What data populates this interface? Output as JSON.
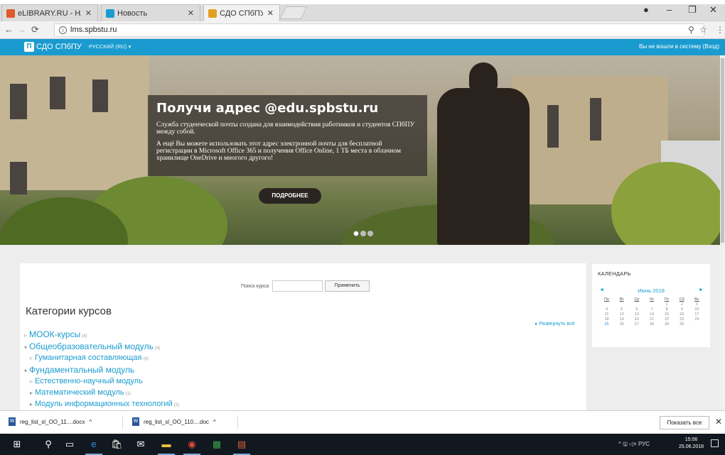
{
  "browser": {
    "tabs": [
      {
        "title": "eLIBRARY.RU - НАУЧНАЯ",
        "close": "✕",
        "color": "#e05a2b"
      },
      {
        "title": "Новость",
        "close": "✕",
        "color": "#1a9bd0"
      },
      {
        "title": "СДО СПбПУ",
        "close": "✕",
        "color": "#e0a020"
      }
    ],
    "url": "lms.spbstu.ru",
    "window_controls": {
      "minimize": "–",
      "maximize": "❐",
      "close": "✕"
    }
  },
  "site": {
    "logo": "П",
    "name": "СДО СПбПУ",
    "language": "РУССКИЙ (RU) ▾",
    "login_text": "Вы не вошли в систему (Вход)"
  },
  "hero": {
    "title": "Получи адрес @edu.spbstu.ru",
    "paragraph1": "Служба студенческой почты создана для взаимодействия работников и студентов СПбПУ между собой.",
    "paragraph2": "А ещё Вы можете использовать этот адрес электронной почты для бесплатной регистрации в Microsoft Office 365 и получения Office Online, 1 ТБ места в облачном хранилище OneDrive и многого другого!",
    "button": "ПОДРОБНЕЕ"
  },
  "course_search": {
    "label": "Поиск курса",
    "value": "",
    "button": "Применить"
  },
  "categories": {
    "title": "Категории курсов",
    "expand_all": "▸ Развернуть всё",
    "items": [
      {
        "arrow": "▹",
        "name": "МООК-курсы",
        "count": "(4)",
        "level": 0
      },
      {
        "arrow": "▾",
        "name": "Общеобразовательный модуль",
        "count": "(4)",
        "level": 0
      },
      {
        "arrow": "▹",
        "name": "Гуманитарная составляющая",
        "count": "(4)",
        "level": 1
      },
      {
        "arrow": "▾",
        "name": "Фундаментальный модуль",
        "count": "",
        "level": 0
      },
      {
        "arrow": "▹",
        "name": "Естественно-научный модуль",
        "count": "",
        "level": 1
      },
      {
        "arrow": "▸",
        "name": "Математический модуль",
        "count": "(1)",
        "level": 1
      },
      {
        "arrow": "▸",
        "name": "Модуль информационных технологий",
        "count": "(2)",
        "level": 1
      }
    ]
  },
  "calendar": {
    "title": "КАЛЕНДАРЬ",
    "prev": "◄",
    "next": "►",
    "month": "Июнь 2018",
    "weekdays": [
      "Пн",
      "Вт",
      "Ср",
      "Чт",
      "Пт",
      "Сб",
      "Вс"
    ],
    "days": [
      "",
      "",
      "",
      "",
      "1",
      "2",
      "3",
      "4",
      "5",
      "6",
      "7",
      "8",
      "9",
      "10",
      "11",
      "12",
      "13",
      "14",
      "15",
      "16",
      "17",
      "18",
      "19",
      "20",
      "21",
      "22",
      "23",
      "24",
      "25",
      "26",
      "27",
      "28",
      "29",
      "30",
      ""
    ],
    "today": "25"
  },
  "downloads": {
    "items": [
      {
        "name": "reg_list_sl_OO_11....docx",
        "caret": "^"
      },
      {
        "name": "reg_list_sl_OO_110....doc",
        "caret": "^"
      }
    ],
    "show_all": "Показать все",
    "close": "✕"
  },
  "taskbar": {
    "tray_text": "^ 🖫 ◁× РУС",
    "time": "15:06",
    "date": "25.06.2018"
  }
}
